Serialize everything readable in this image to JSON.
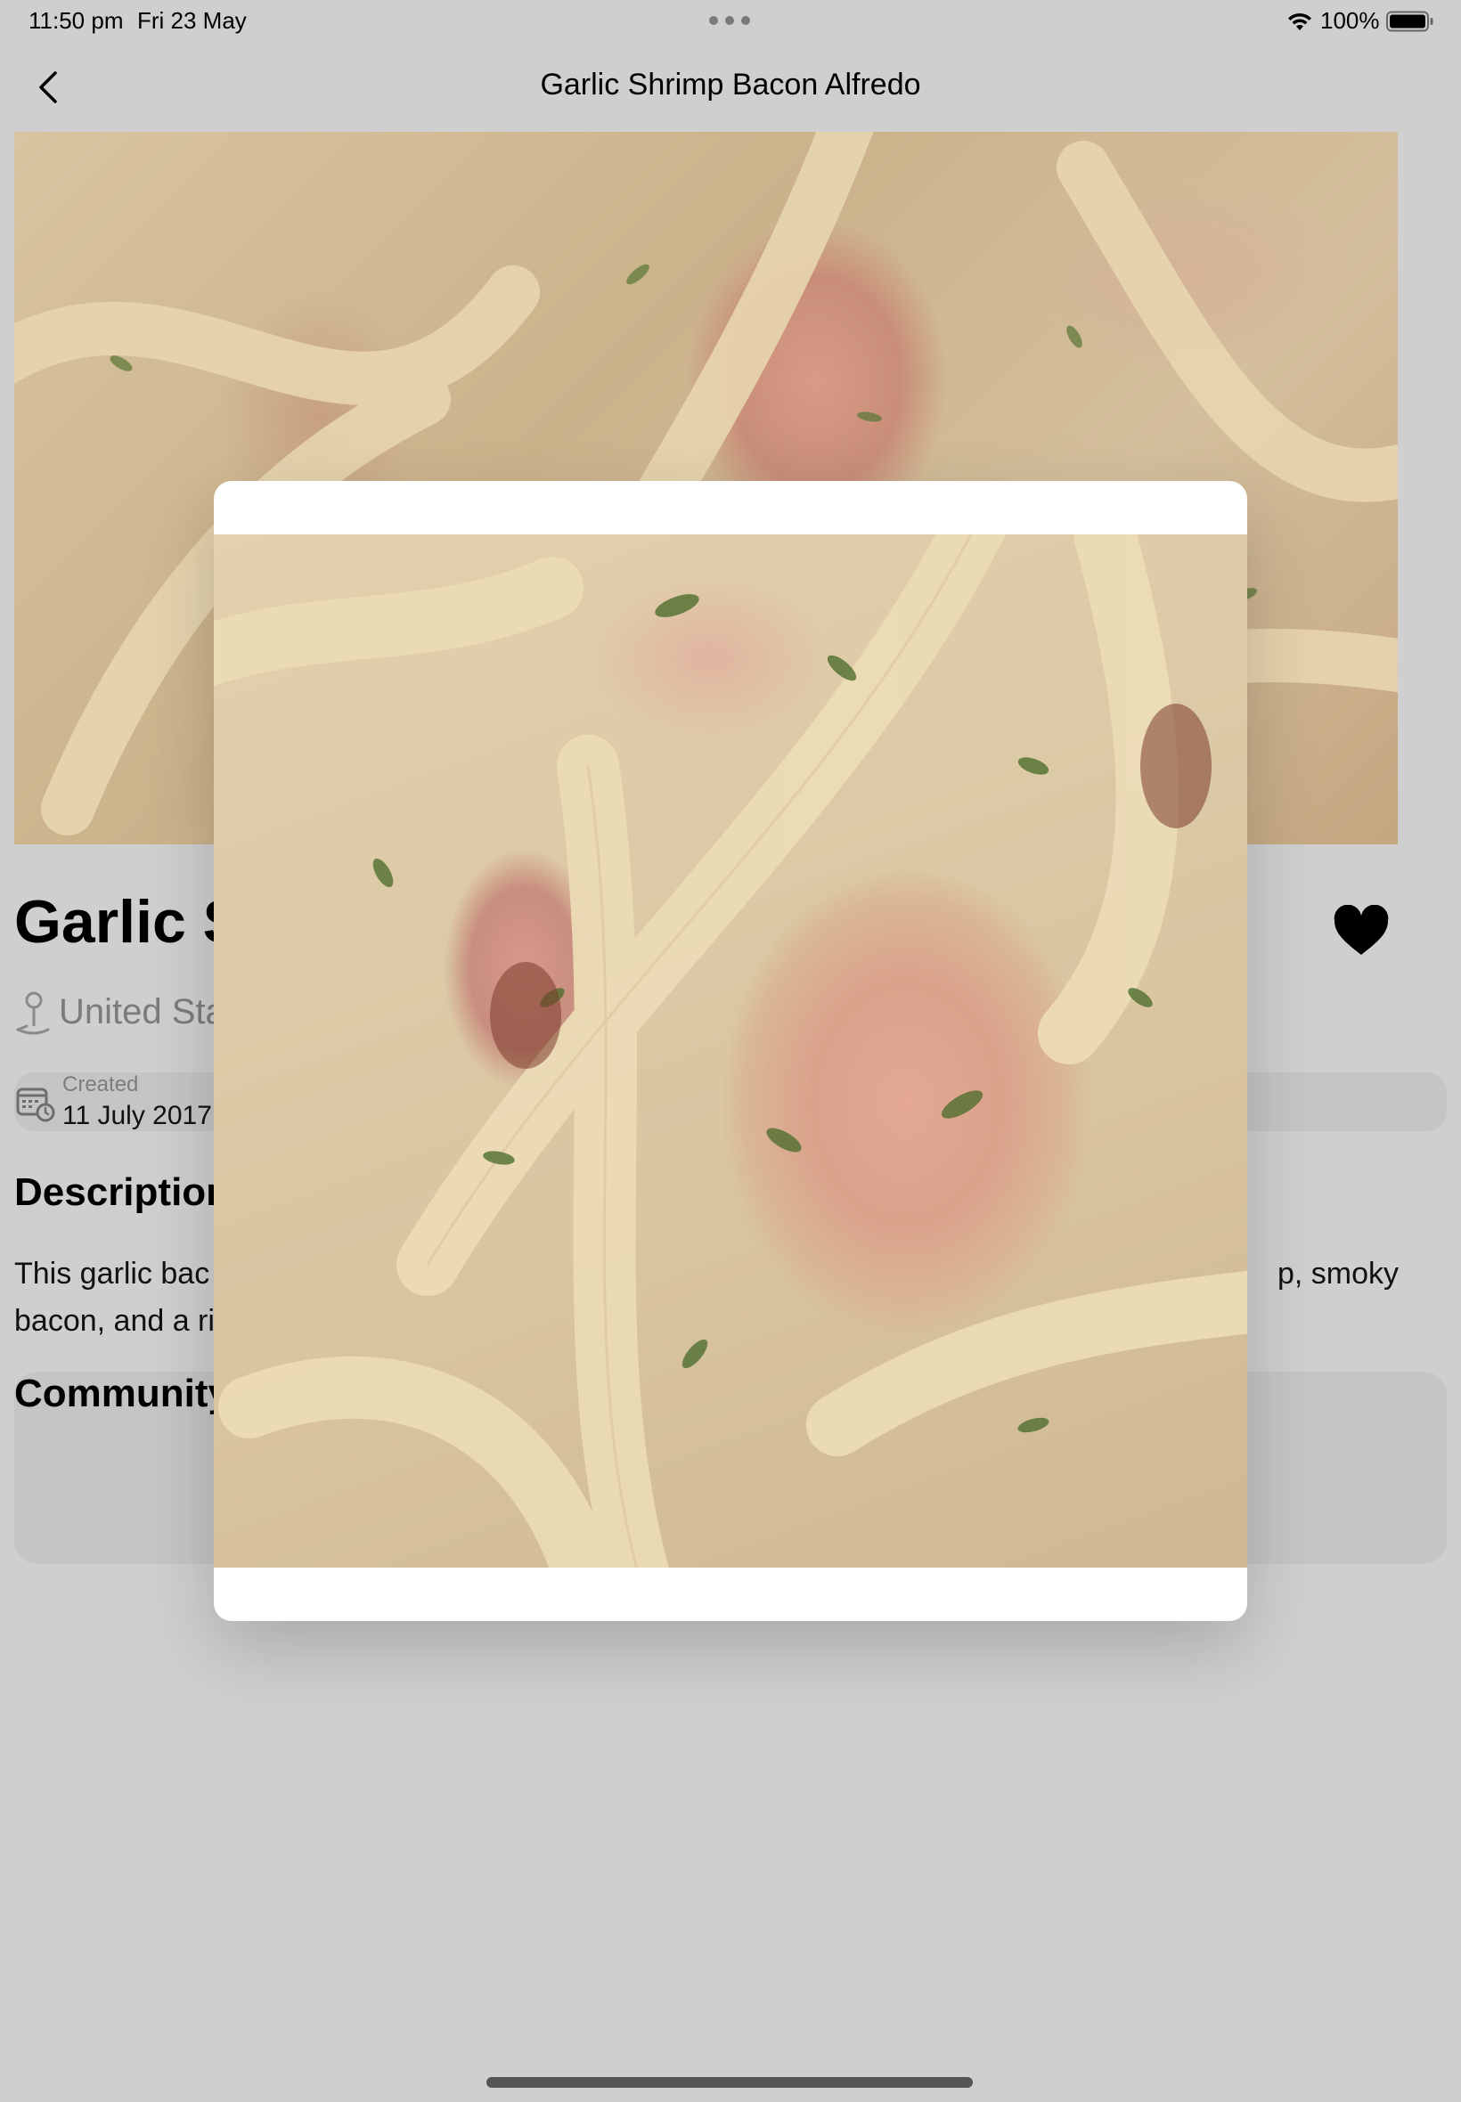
{
  "status_bar": {
    "time": "11:50 pm",
    "date": "Fri 23 May",
    "battery": "100%"
  },
  "nav": {
    "title": "Garlic Shrimp Bacon Alfredo"
  },
  "recipe": {
    "title_visible": "Garlic S",
    "location_visible": "United Sta",
    "created_label": "Created",
    "created_value_visible": "11 July 2017",
    "description_heading_visible": "Description",
    "description_line1_start": "This garlic bac",
    "description_line1_end": "p, smoky",
    "description_line2_start": "bacon, and a ri",
    "community_heading_visible": "Community",
    "favorited": true
  },
  "icons": {
    "back": "chevron-left-icon",
    "favorite": "heart-filled-icon",
    "location": "map-pin-icon",
    "created": "calendar-clock-icon",
    "wifi": "wifi-icon",
    "battery": "battery-full-icon"
  },
  "colors": {
    "background": "#cfcfcf",
    "card": "#c5c5c7",
    "modal": "#ffffff",
    "secondary_text": "#7b7b7b"
  }
}
